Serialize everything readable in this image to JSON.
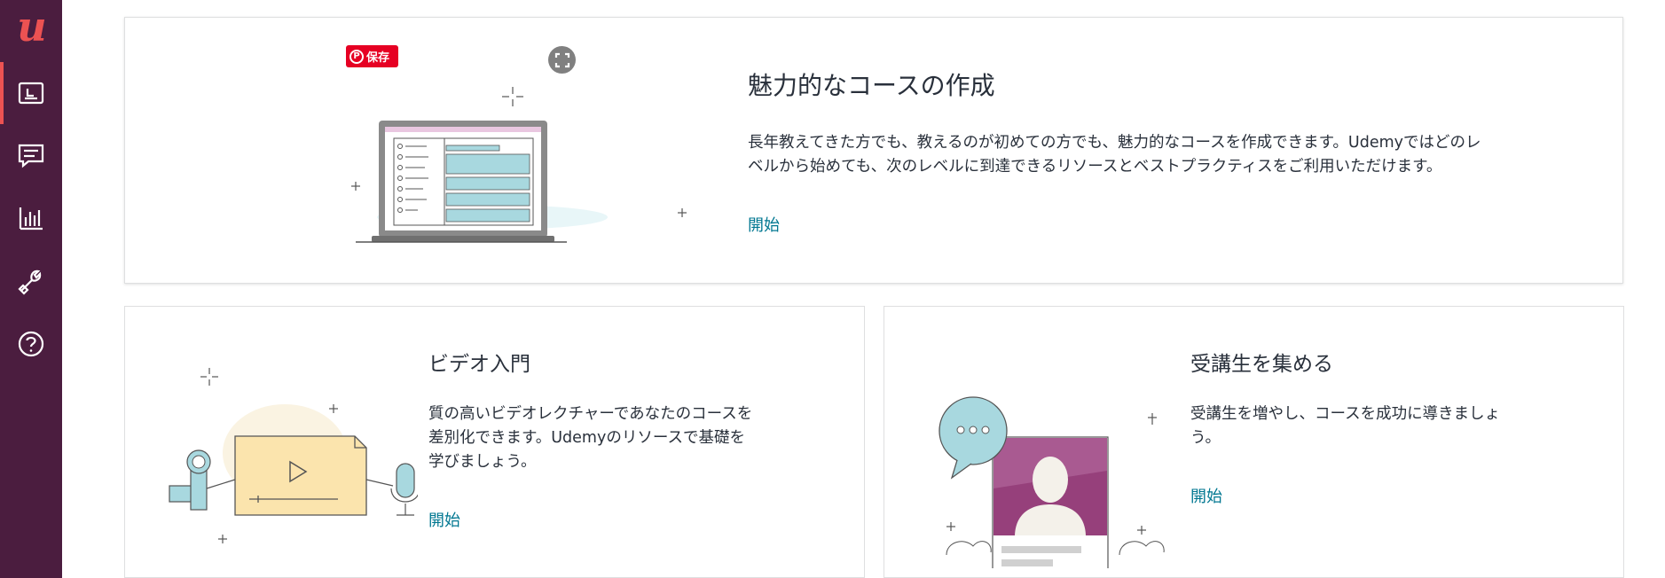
{
  "sidebar": {
    "logo": "u",
    "items": [
      {
        "icon": "course-icon",
        "active": true
      },
      {
        "icon": "message-icon",
        "active": false
      },
      {
        "icon": "analytics-icon",
        "active": false
      },
      {
        "icon": "tools-icon",
        "active": false
      },
      {
        "icon": "help-icon",
        "active": false
      }
    ]
  },
  "hero": {
    "pin_label": "保存",
    "title": "魅力的なコースの作成",
    "description_line1": "長年教えてきた方でも、教えるのが初めての方でも、魅力的なコースを作成できます。Udemyではどのレ",
    "description_line2": "ベルから始めても、次のレベルに到達できるリソースとベストプラクティスをご利用いただけます。",
    "link": "開始"
  },
  "video_card": {
    "title": "ビデオ入門",
    "description_line1": "質の高いビデオレクチャーであなたのコースを",
    "description_line2": "差別化できます。Udemyのリソースで基礎を",
    "description_line3": "学びましょう。",
    "link": "開始"
  },
  "audience_card": {
    "title": "受講生を集める",
    "description_line1": "受講生を増やし、コースを成功に導きましょ",
    "description_line2": "う。",
    "link": "開始"
  },
  "colors": {
    "sidebar": "#4b1d3f",
    "accent": "#ec5252",
    "link": "#007791",
    "illustration_blue": "#a8d8df",
    "illustration_yellow": "#fbe4ad",
    "illustration_purple": "#96407b"
  }
}
